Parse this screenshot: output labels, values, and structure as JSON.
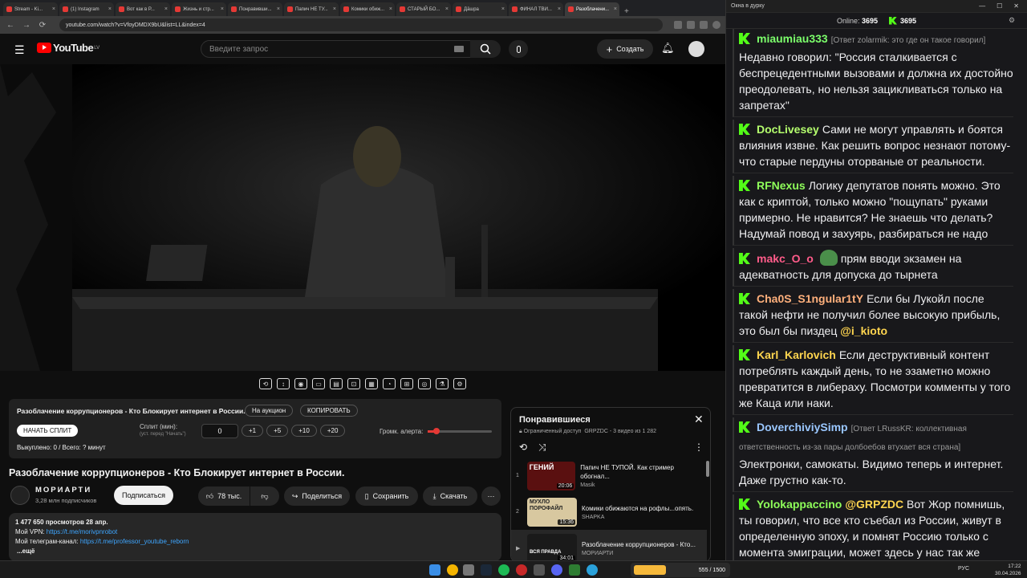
{
  "browser": {
    "tabs": [
      "Stream - Ki...",
      "(1) Instagram",
      "Вот как в Р...",
      "Жизнь и стр...",
      "Понравивши...",
      "Папич НЕ ТУ...",
      "Комики обиж...",
      "СТАРЫЙ БО...",
      "Дāшра",
      "ФИНАЛ ТВИ...",
      "Разоблачени..."
    ],
    "url": "youtube.com/watch?v=VfoyDMDX9bU&list=LL&index=4"
  },
  "yt": {
    "logo": "YouTube",
    "country": "LV",
    "search_placeholder": "Введите запрос",
    "create_label": "Создать"
  },
  "auction": {
    "title": "Разоблачение коррупционеров - Кто Блокирует интернет в России.",
    "on_auction": "На аукцион",
    "copy": "КОПИРОВАТЬ",
    "start_split": "НАЧАТЬ СПЛИТ",
    "split_label": "Сплит (мин):",
    "split_hint": "(уст. перед \"Начать\")",
    "split_value": "0",
    "inc": [
      "+1",
      "+5",
      "+10",
      "+20"
    ],
    "volume_label": "Громк. алерта:",
    "bought": "Выкуплено: 0 / Всего: ? минут"
  },
  "video": {
    "title": "Разоблачение коррупционеров - Кто Блокирует интернет в России.",
    "channel": "МОРИАРТИ",
    "subs": "3,28 млн подписчиков",
    "subscribe": "Подписаться",
    "likes": "78 тыс.",
    "share": "Поделиться",
    "save": "Сохранить",
    "download": "Скачать",
    "views": "1 477 650 просмотров  28 апр.",
    "vpn_label": "Мой VPN: ",
    "vpn_link": "https://t.me/morivpnrobot",
    "tg_label": "Мой телеграм-канал: ",
    "tg_link": "https://t.me/professor_youtube_reborn",
    "more": "...ещё"
  },
  "playlist": {
    "title": "Понравившиеся",
    "access": "Ограниченный доступ",
    "meta": "GRPZDC - 3 видео из 1 282",
    "items": [
      {
        "num": "1",
        "title": "Папич НЕ ТУПОЙ. Как стример обогнал...",
        "channel": "Masik",
        "dur": "20:06",
        "thumb": "ГЕНИЙ"
      },
      {
        "num": "2",
        "title": "Комики обижаются на рофлы...опять.",
        "channel": "SHAPKA",
        "dur": "15:36",
        "thumb": "МУХЛО ПОРОФАЙЛ"
      },
      {
        "num": "▶",
        "title": "Разоблачение коррупционеров - Кто...",
        "channel": "МОРИАРТИ",
        "dur": "34:01",
        "thumb": "ВСЯ ПРАВДА"
      }
    ]
  },
  "chat": {
    "window_title": "Окна в дурку",
    "online_label": "Online:",
    "online": "3695",
    "viewers": "3695",
    "messages": [
      {
        "user": "miaumiau333",
        "color": "#7cff6b",
        "reply": "[Ответ zolarmik: это где он такое говорил]",
        "text": "Недавно говорил: \"Россия сталкивается с беспрецедентными вызовами и должна их достойно преодолевать, но нельзя зацикливаться только на запретах\""
      },
      {
        "user": "DocLivesey",
        "color": "#8fff5a",
        "text": "Сами не могут управлять и боятся влияния извне. Как решить вопрос незнают потому-что старые пердуны оторваные от реальности."
      },
      {
        "user": "RFNexus",
        "color": "#8fff5a",
        "text": "Логику депутатов понять можно. Это как с криптой, только можно \"пощупать\" руками примерно. Не нравится? Не знаешь что делать? Надумай повод и захуярь, разбираться не надо"
      },
      {
        "user": "makc_O_o",
        "color": "#ff5c8a",
        "text": "прям вводи экзамен на адекватность для допуска до тырнета"
      },
      {
        "user": "Cha0S_S1ngular1tY",
        "color": "#ffb07c",
        "text": "Если бы Лукойл после такой нефти не получил более высокую прибыль, это был бы пиздец",
        "mention": "@i_kioto"
      },
      {
        "user": "Karl_Karlovich",
        "color": "#ffd54f",
        "text": "Если деструктивный контент потреблять каждый день, то не эзаметно можно превратится в либераху. Посмотри комменты у того же Каца или наки."
      },
      {
        "user": "DoverchiviySimp",
        "color": "#9ac7ff",
        "reply": "[Ответ LRussKR: коллективная ответственность из-за пары долбоебов втухает вся страна]",
        "text": "Электронки, самокаты. Видимо теперь и интернет. Даже грустно как-то."
      },
      {
        "user": "Yolokappaccino",
        "color": "#8fff5a",
        "mention": "@GRPZDC",
        "text": "Вот Жор помнишь, ты говорил, что все кто съебал из России, живут в определенную эпоху, и помнят Россию только с момента эмиграции, может здесь у нас так же"
      }
    ]
  },
  "taskbar": {
    "lang": "РУС",
    "time": "17:22",
    "date": "30.04.2026",
    "widget": "555 / 1500"
  }
}
